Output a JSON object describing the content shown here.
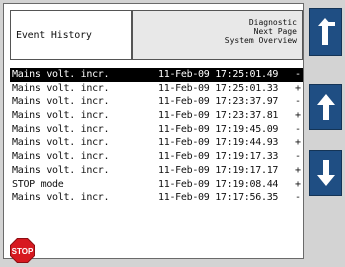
{
  "header": {
    "title": "Event History",
    "menu": {
      "diagnostic_label": "Diagnostic",
      "next_page_label": "Next Page",
      "system_overview_label": "System Overview"
    }
  },
  "events": [
    {
      "name": "Mains volt. incr.",
      "timestamp": "11-Feb-09 17:25:01.49",
      "flag": "-",
      "selected": true
    },
    {
      "name": "Mains volt. incr.",
      "timestamp": "11-Feb-09 17:25:01.33",
      "flag": "+"
    },
    {
      "name": "Mains volt. incr.",
      "timestamp": "11-Feb-09 17:23:37.97",
      "flag": "-"
    },
    {
      "name": "Mains volt. incr.",
      "timestamp": "11-Feb-09 17:23:37.81",
      "flag": "+"
    },
    {
      "name": "Mains volt. incr.",
      "timestamp": "11-Feb-09 17:19:45.09",
      "flag": "-"
    },
    {
      "name": "Mains volt. incr.",
      "timestamp": "11-Feb-09 17:19:44.93",
      "flag": "+"
    },
    {
      "name": "Mains volt. incr.",
      "timestamp": "11-Feb-09 17:19:17.33",
      "flag": "-"
    },
    {
      "name": "Mains volt. incr.",
      "timestamp": "11-Feb-09 17:19:17.17",
      "flag": "+"
    },
    {
      "name": "STOP mode",
      "timestamp": "11-Feb-09 17:19:08.44",
      "flag": "+"
    },
    {
      "name": "Mains volt. incr.",
      "timestamp": "11-Feb-09 17:17:56.35",
      "flag": "-"
    }
  ],
  "stop_button": {
    "label": "STOP",
    "color": "#d71920"
  },
  "side_buttons": {
    "color": "#1f4e83",
    "items": [
      {
        "icon": "corner-arrow-icon",
        "action": "menu"
      },
      {
        "icon": "arrow-up-icon",
        "action": "scroll-up"
      },
      {
        "icon": "arrow-down-icon",
        "action": "scroll-down"
      }
    ]
  }
}
